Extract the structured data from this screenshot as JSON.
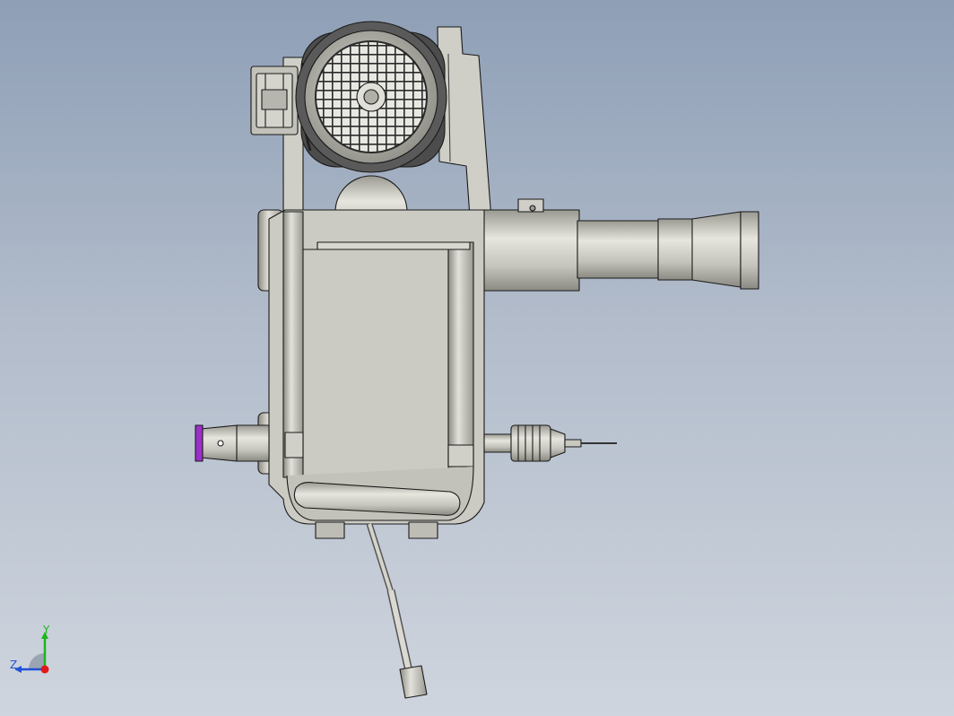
{
  "view": {
    "background_top": "#8e9fb6",
    "background_bottom": "#cfd5de",
    "part_color": "#c9c9c1",
    "part_shadow": "#8e8e86",
    "edge_color": "#1a1a1a",
    "collet_accent": "#9b30c8"
  },
  "triad": {
    "y_label": "Y",
    "z_label": "Z",
    "y_color": "#1cb51c",
    "z_color": "#2050d8",
    "x_color": "#e01818"
  }
}
